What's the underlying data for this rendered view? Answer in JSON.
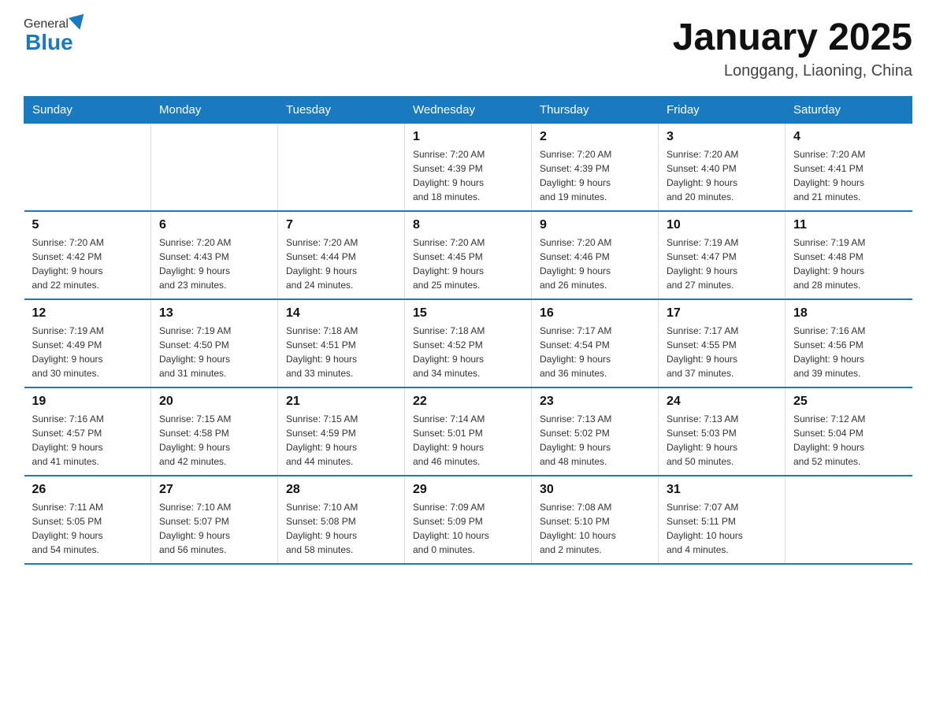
{
  "header": {
    "logo_general": "General",
    "logo_blue": "Blue",
    "title": "January 2025",
    "subtitle": "Longgang, Liaoning, China"
  },
  "days_of_week": [
    "Sunday",
    "Monday",
    "Tuesday",
    "Wednesday",
    "Thursday",
    "Friday",
    "Saturday"
  ],
  "weeks": [
    [
      {
        "day": "",
        "info": ""
      },
      {
        "day": "",
        "info": ""
      },
      {
        "day": "",
        "info": ""
      },
      {
        "day": "1",
        "info": "Sunrise: 7:20 AM\nSunset: 4:39 PM\nDaylight: 9 hours\nand 18 minutes."
      },
      {
        "day": "2",
        "info": "Sunrise: 7:20 AM\nSunset: 4:39 PM\nDaylight: 9 hours\nand 19 minutes."
      },
      {
        "day": "3",
        "info": "Sunrise: 7:20 AM\nSunset: 4:40 PM\nDaylight: 9 hours\nand 20 minutes."
      },
      {
        "day": "4",
        "info": "Sunrise: 7:20 AM\nSunset: 4:41 PM\nDaylight: 9 hours\nand 21 minutes."
      }
    ],
    [
      {
        "day": "5",
        "info": "Sunrise: 7:20 AM\nSunset: 4:42 PM\nDaylight: 9 hours\nand 22 minutes."
      },
      {
        "day": "6",
        "info": "Sunrise: 7:20 AM\nSunset: 4:43 PM\nDaylight: 9 hours\nand 23 minutes."
      },
      {
        "day": "7",
        "info": "Sunrise: 7:20 AM\nSunset: 4:44 PM\nDaylight: 9 hours\nand 24 minutes."
      },
      {
        "day": "8",
        "info": "Sunrise: 7:20 AM\nSunset: 4:45 PM\nDaylight: 9 hours\nand 25 minutes."
      },
      {
        "day": "9",
        "info": "Sunrise: 7:20 AM\nSunset: 4:46 PM\nDaylight: 9 hours\nand 26 minutes."
      },
      {
        "day": "10",
        "info": "Sunrise: 7:19 AM\nSunset: 4:47 PM\nDaylight: 9 hours\nand 27 minutes."
      },
      {
        "day": "11",
        "info": "Sunrise: 7:19 AM\nSunset: 4:48 PM\nDaylight: 9 hours\nand 28 minutes."
      }
    ],
    [
      {
        "day": "12",
        "info": "Sunrise: 7:19 AM\nSunset: 4:49 PM\nDaylight: 9 hours\nand 30 minutes."
      },
      {
        "day": "13",
        "info": "Sunrise: 7:19 AM\nSunset: 4:50 PM\nDaylight: 9 hours\nand 31 minutes."
      },
      {
        "day": "14",
        "info": "Sunrise: 7:18 AM\nSunset: 4:51 PM\nDaylight: 9 hours\nand 33 minutes."
      },
      {
        "day": "15",
        "info": "Sunrise: 7:18 AM\nSunset: 4:52 PM\nDaylight: 9 hours\nand 34 minutes."
      },
      {
        "day": "16",
        "info": "Sunrise: 7:17 AM\nSunset: 4:54 PM\nDaylight: 9 hours\nand 36 minutes."
      },
      {
        "day": "17",
        "info": "Sunrise: 7:17 AM\nSunset: 4:55 PM\nDaylight: 9 hours\nand 37 minutes."
      },
      {
        "day": "18",
        "info": "Sunrise: 7:16 AM\nSunset: 4:56 PM\nDaylight: 9 hours\nand 39 minutes."
      }
    ],
    [
      {
        "day": "19",
        "info": "Sunrise: 7:16 AM\nSunset: 4:57 PM\nDaylight: 9 hours\nand 41 minutes."
      },
      {
        "day": "20",
        "info": "Sunrise: 7:15 AM\nSunset: 4:58 PM\nDaylight: 9 hours\nand 42 minutes."
      },
      {
        "day": "21",
        "info": "Sunrise: 7:15 AM\nSunset: 4:59 PM\nDaylight: 9 hours\nand 44 minutes."
      },
      {
        "day": "22",
        "info": "Sunrise: 7:14 AM\nSunset: 5:01 PM\nDaylight: 9 hours\nand 46 minutes."
      },
      {
        "day": "23",
        "info": "Sunrise: 7:13 AM\nSunset: 5:02 PM\nDaylight: 9 hours\nand 48 minutes."
      },
      {
        "day": "24",
        "info": "Sunrise: 7:13 AM\nSunset: 5:03 PM\nDaylight: 9 hours\nand 50 minutes."
      },
      {
        "day": "25",
        "info": "Sunrise: 7:12 AM\nSunset: 5:04 PM\nDaylight: 9 hours\nand 52 minutes."
      }
    ],
    [
      {
        "day": "26",
        "info": "Sunrise: 7:11 AM\nSunset: 5:05 PM\nDaylight: 9 hours\nand 54 minutes."
      },
      {
        "day": "27",
        "info": "Sunrise: 7:10 AM\nSunset: 5:07 PM\nDaylight: 9 hours\nand 56 minutes."
      },
      {
        "day": "28",
        "info": "Sunrise: 7:10 AM\nSunset: 5:08 PM\nDaylight: 9 hours\nand 58 minutes."
      },
      {
        "day": "29",
        "info": "Sunrise: 7:09 AM\nSunset: 5:09 PM\nDaylight: 10 hours\nand 0 minutes."
      },
      {
        "day": "30",
        "info": "Sunrise: 7:08 AM\nSunset: 5:10 PM\nDaylight: 10 hours\nand 2 minutes."
      },
      {
        "day": "31",
        "info": "Sunrise: 7:07 AM\nSunset: 5:11 PM\nDaylight: 10 hours\nand 4 minutes."
      },
      {
        "day": "",
        "info": ""
      }
    ]
  ]
}
